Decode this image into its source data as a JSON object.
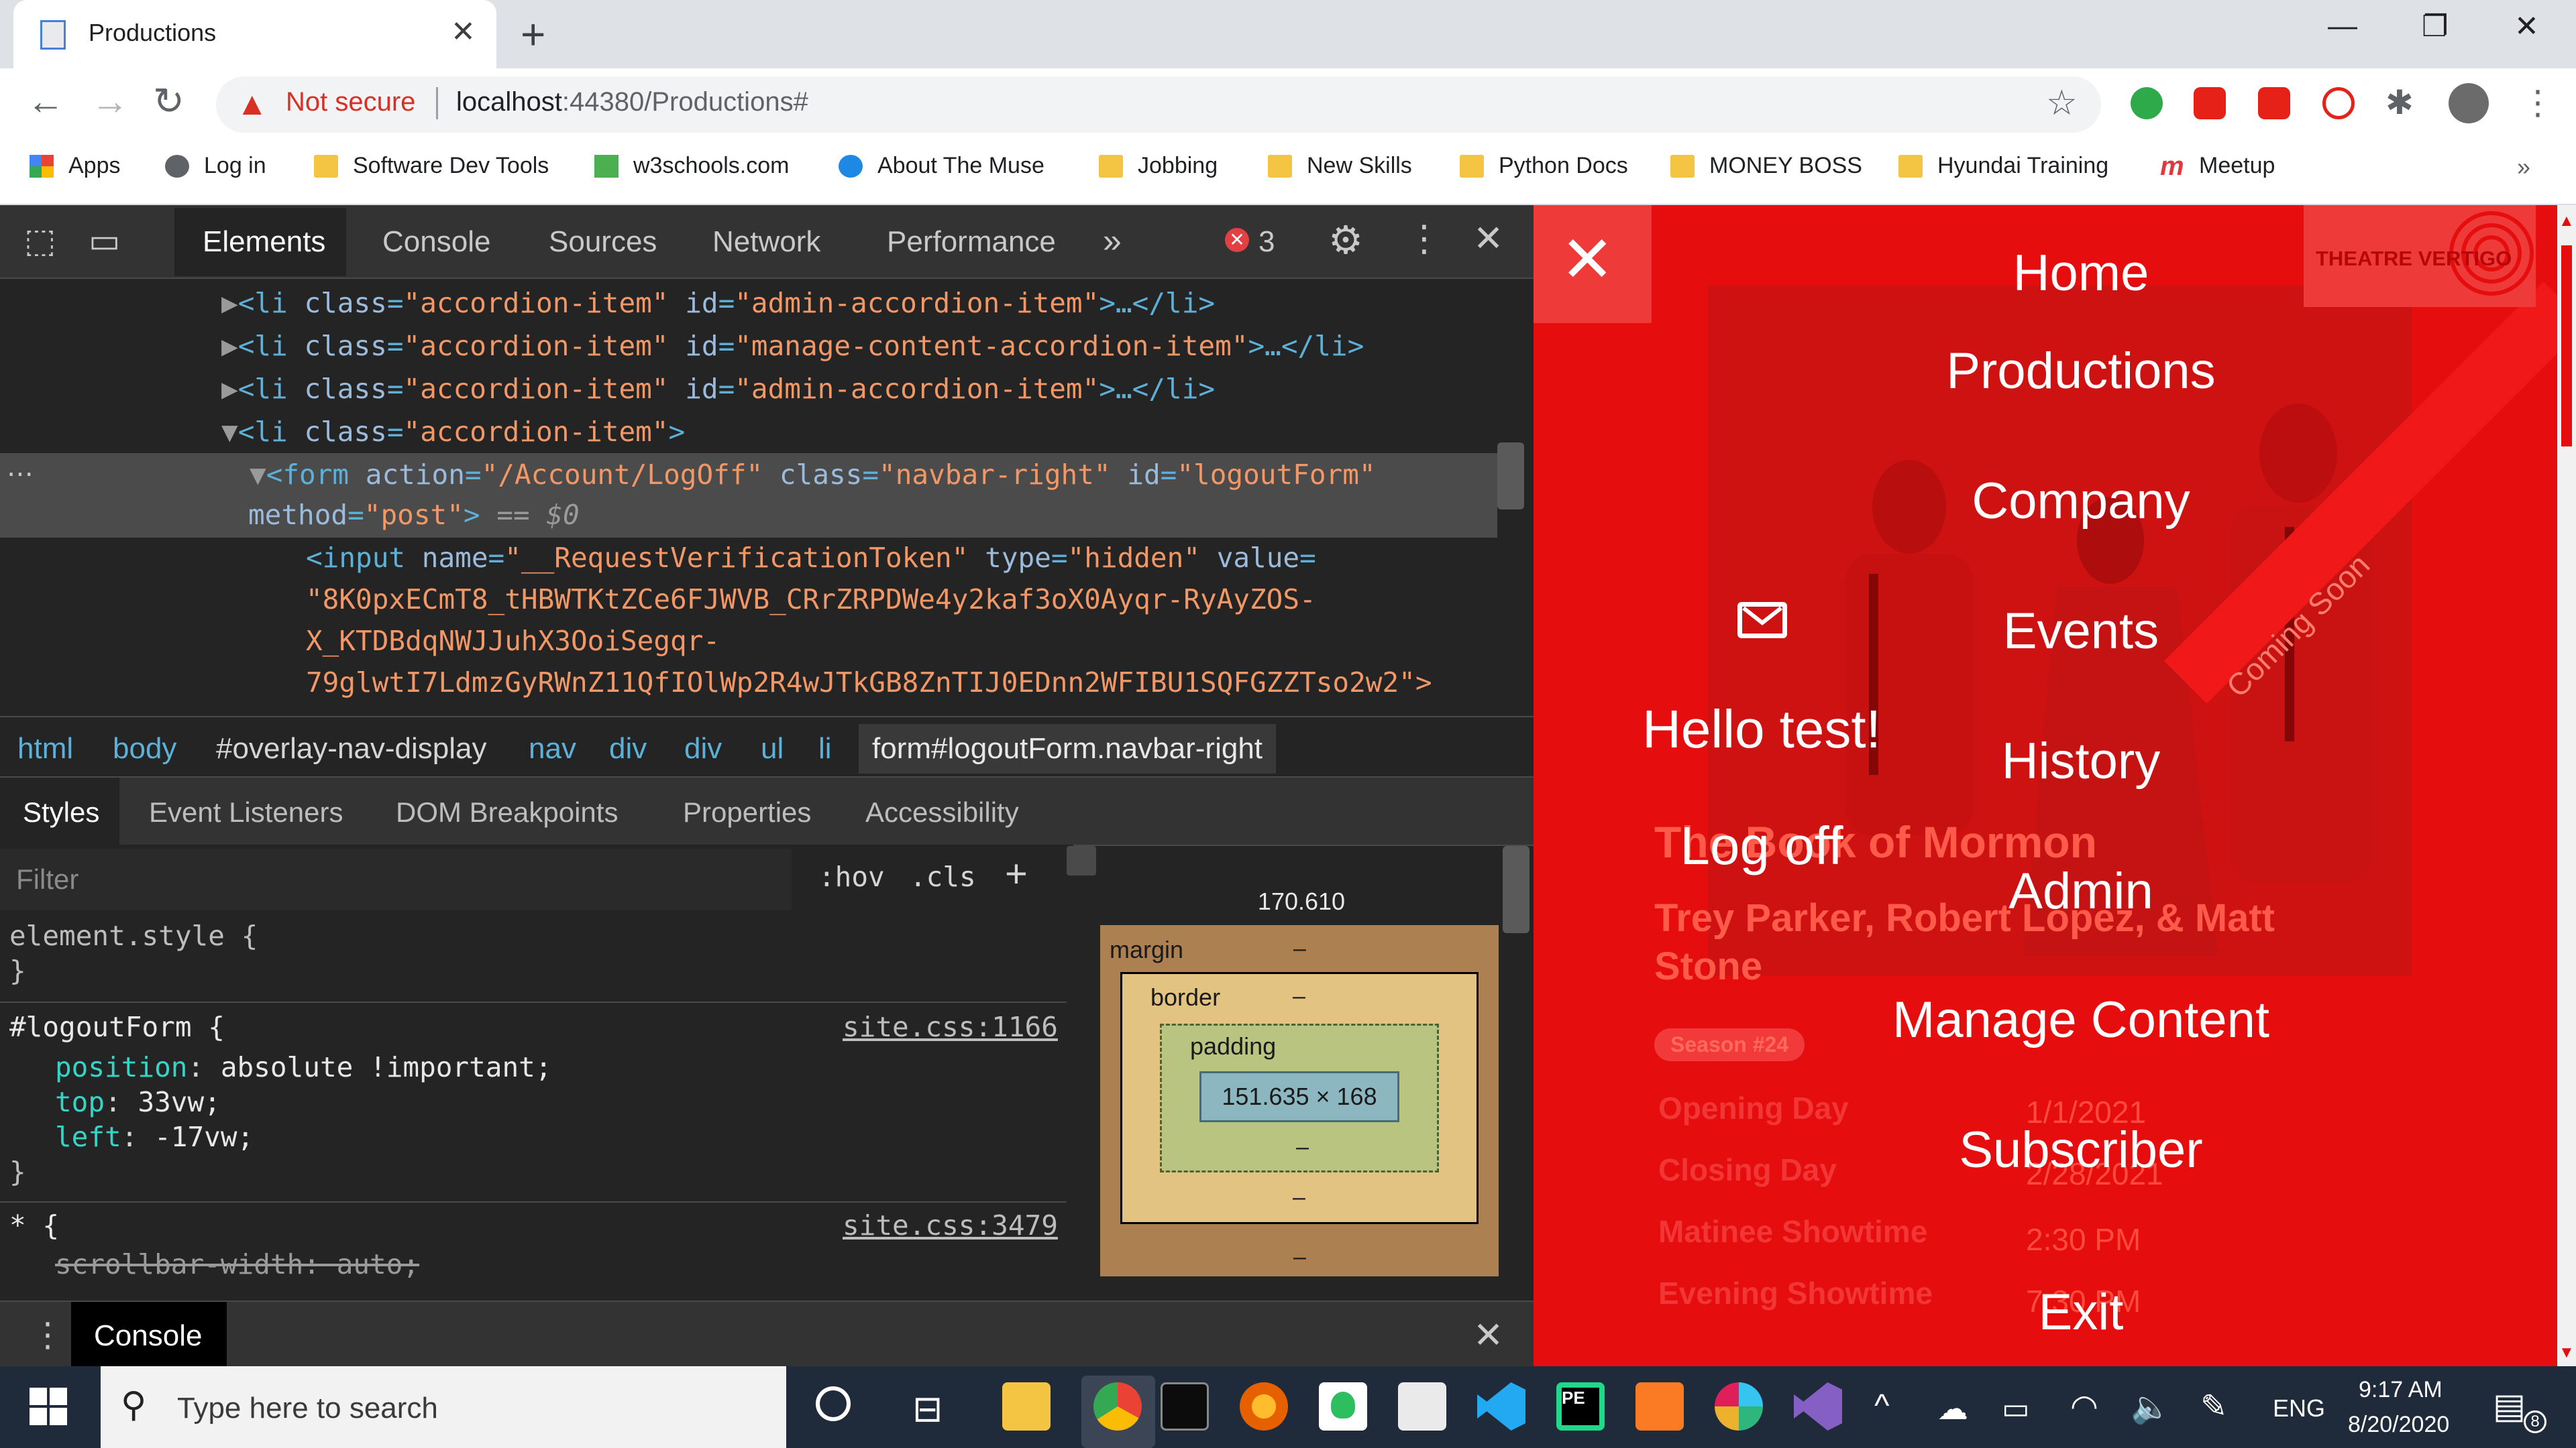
{
  "browser": {
    "tab_title": "Productions",
    "not_secure": "Not secure",
    "url_host": "localhost",
    "url_rest": ":44380/Productions#",
    "bookmarks": [
      "Apps",
      "Log in",
      "Software Dev Tools",
      "w3schools.com",
      "About The Muse",
      "Jobbing",
      "New Skills",
      "Python Docs",
      "MONEY BOSS",
      "Hyundai Training",
      "Meetup"
    ]
  },
  "devtools": {
    "tabs": [
      "Elements",
      "Console",
      "Sources",
      "Network",
      "Performance"
    ],
    "error_count": "3",
    "dom_lines": [
      {
        "indent": "▶",
        "tag_open": "<li ",
        "attrs": [
          [
            "class",
            "\"accordion-item\""
          ],
          [
            "id",
            "\"admin-accordion-item\""
          ]
        ],
        "tail": ">…</li>"
      },
      {
        "indent": "▶",
        "tag_open": "<li ",
        "attrs": [
          [
            "class",
            "\"accordion-item\""
          ],
          [
            "id",
            "\"manage-content-accordion-item\""
          ]
        ],
        "tail": ">…</li>"
      },
      {
        "indent": "▶",
        "tag_open": "<li ",
        "attrs": [
          [
            "class",
            "\"accordion-item\""
          ],
          [
            "id",
            "\"admin-accordion-item\""
          ]
        ],
        "tail": ">…</li>"
      },
      {
        "indent": "▼",
        "tag_open": "<li ",
        "attrs": [
          [
            "class",
            "\"accordion-item\""
          ]
        ],
        "tail": ">"
      }
    ],
    "form_line1": "<form action=\"/Account/LogOff\" class=\"navbar-right\" id=\"logoutForm\"",
    "form_line2": "method=\"post\"> == $0",
    "input_line1": "<input name=\"__RequestVerificationToken\" type=\"hidden\" value=",
    "input_line2": "\"8K0pxECmT8_tHBWTKtZCe6FJWVB_CRrZRPDWe4y2kaf3oX0Ayqr-RyAyZOS-",
    "input_line3": "X_KTDBdqNWJJuhX3OoiSegqr-",
    "input_line4": "79glwtI7LdmzGyRWnZ11QfIOlWp2R4wJTkGB8ZnTIJ0EDnn2WFIBU1SQFGZZTso2w2\">",
    "breadcrumbs": [
      "html",
      "body",
      "#overlay-nav-display",
      "nav",
      "div",
      "div",
      "ul",
      "li",
      "form#logoutForm.navbar-right"
    ],
    "subtabs": [
      "Styles",
      "Event Listeners",
      "DOM Breakpoints",
      "Properties",
      "Accessibility"
    ],
    "filter_placeholder": "Filter",
    "hov": ":hov",
    "cls": ".cls",
    "element_style": "element.style {",
    "close_brace": "}",
    "rule_selector": "#logoutForm {",
    "rule_source": "site.css:1166",
    "decl1_prop": "position",
    "decl1_val": "absolute !important;",
    "decl2_prop": "top",
    "decl2_val": "33vw;",
    "decl3_prop": "left",
    "decl3_val": "-17vw;",
    "star_selector": "* {",
    "star_source": "site.css:3479",
    "struck_decl": "scrollbar-width: auto;",
    "box_top": "170.610",
    "box_margin": "margin",
    "box_border": "border",
    "box_padding": "padding",
    "box_dash": "–",
    "box_content": "151.635 × 168",
    "console_label": "Console"
  },
  "page": {
    "logo_text": "THEATRE VERTIGO",
    "nav": [
      "Home",
      "Productions",
      "Company",
      "Events",
      "History",
      "Admin",
      "Manage Content",
      "Subscriber",
      "Exit"
    ],
    "hello": "Hello test!",
    "logoff": "Log off",
    "coming_soon": "Coming Soon",
    "show_title": "The Book of Mormon",
    "authors": "Trey Parker, Robert Lopez, & Matt Stone",
    "season": "Season #24",
    "details": [
      {
        "label": "Opening Day",
        "value": "1/1/2021"
      },
      {
        "label": "Closing Day",
        "value": "2/28/2021"
      },
      {
        "label": "Matinee Showtime",
        "value": "2:30 PM"
      },
      {
        "label": "Evening Showtime",
        "value": "7:30 PM"
      }
    ]
  },
  "taskbar": {
    "search_placeholder": "Type here to search",
    "lang": "ENG",
    "time": "9:17 AM",
    "date": "8/20/2020",
    "notif_count": "8"
  }
}
